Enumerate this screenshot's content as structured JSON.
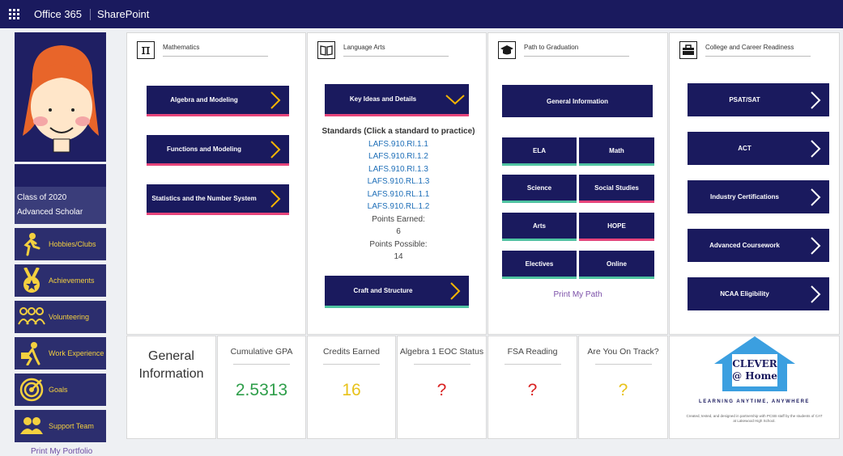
{
  "topbar": {
    "waffle": "app-launcher-icon",
    "brand": "Office 365",
    "site": "SharePoint"
  },
  "sidebar": {
    "class_of": "Class of 2020",
    "track": "Advanced Scholar",
    "buttons": [
      {
        "label": "Hobbies/Clubs",
        "icon": "runner-icon"
      },
      {
        "label": "Achievements",
        "icon": "medal-icon"
      },
      {
        "label": "Volunteering",
        "icon": "people-icon"
      },
      {
        "label": "Work Experience",
        "icon": "worker-icon"
      },
      {
        "label": "Goals",
        "icon": "target-icon"
      },
      {
        "label": "Support Team",
        "icon": "team-icon"
      }
    ],
    "print_portfolio": "Print My Portfolio"
  },
  "math": {
    "title": "Mathematics",
    "buttons": [
      "Algebra and Modeling",
      "Functions and Modeling",
      "Statistics and the Number System"
    ]
  },
  "language": {
    "title": "Language Arts",
    "expanded_button": "Key Ideas and Details",
    "standards_heading": "Standards (Click a standard to practice)",
    "standards": [
      "LAFS.910.RI.1.1",
      "LAFS.910.RI.1.2",
      "LAFS.910.RI.1.3",
      "LAFS.910.RL.1.3",
      "LAFS.910.RL.1.1",
      "LAFS.910.RL.1.2"
    ],
    "points_earned_label": "Points Earned:",
    "points_earned": "6",
    "points_possible_label": "Points Possible:",
    "points_possible": "14",
    "second_button": "Craft and Structure"
  },
  "graduation": {
    "title": "Path to Graduation",
    "general": "General Information",
    "grid": [
      "ELA",
      "Math",
      "Science",
      "Social Studies",
      "Arts",
      "HOPE",
      "Electives",
      "Online"
    ],
    "print": "Print My Path"
  },
  "career": {
    "title": "College and Career Readiness",
    "buttons": [
      "PSAT/SAT",
      "ACT",
      "Industry Certifications",
      "Advanced Coursework",
      "NCAA Eligibility"
    ]
  },
  "stats": {
    "general": "General Information",
    "items": [
      {
        "label": "Cumulative GPA",
        "value": "2.5313",
        "color": "#2e9e4a"
      },
      {
        "label": "Credits Earned",
        "value": "16",
        "color": "#e8c21a"
      },
      {
        "label": "Algebra 1 EOC Status",
        "value": "?",
        "color": "#d92020"
      },
      {
        "label": "FSA Reading",
        "value": "?",
        "color": "#d92020"
      },
      {
        "label": "Are You On Track?",
        "value": "?",
        "color": "#e8c21a"
      }
    ]
  },
  "logo": {
    "line1": "CLEVER",
    "line2": "@ Home",
    "tagline": "LEARNING ANYTIME, ANYWHERE",
    "credit": "Created, tested, and designed in partnership with PCSB staff by the students of CAT at Lakewood High School."
  },
  "colors": {
    "navy": "#1a1a5e",
    "pink_accent": "#e6447a",
    "green_accent": "#4fc3a1",
    "house_blue": "#3b9fe0"
  }
}
